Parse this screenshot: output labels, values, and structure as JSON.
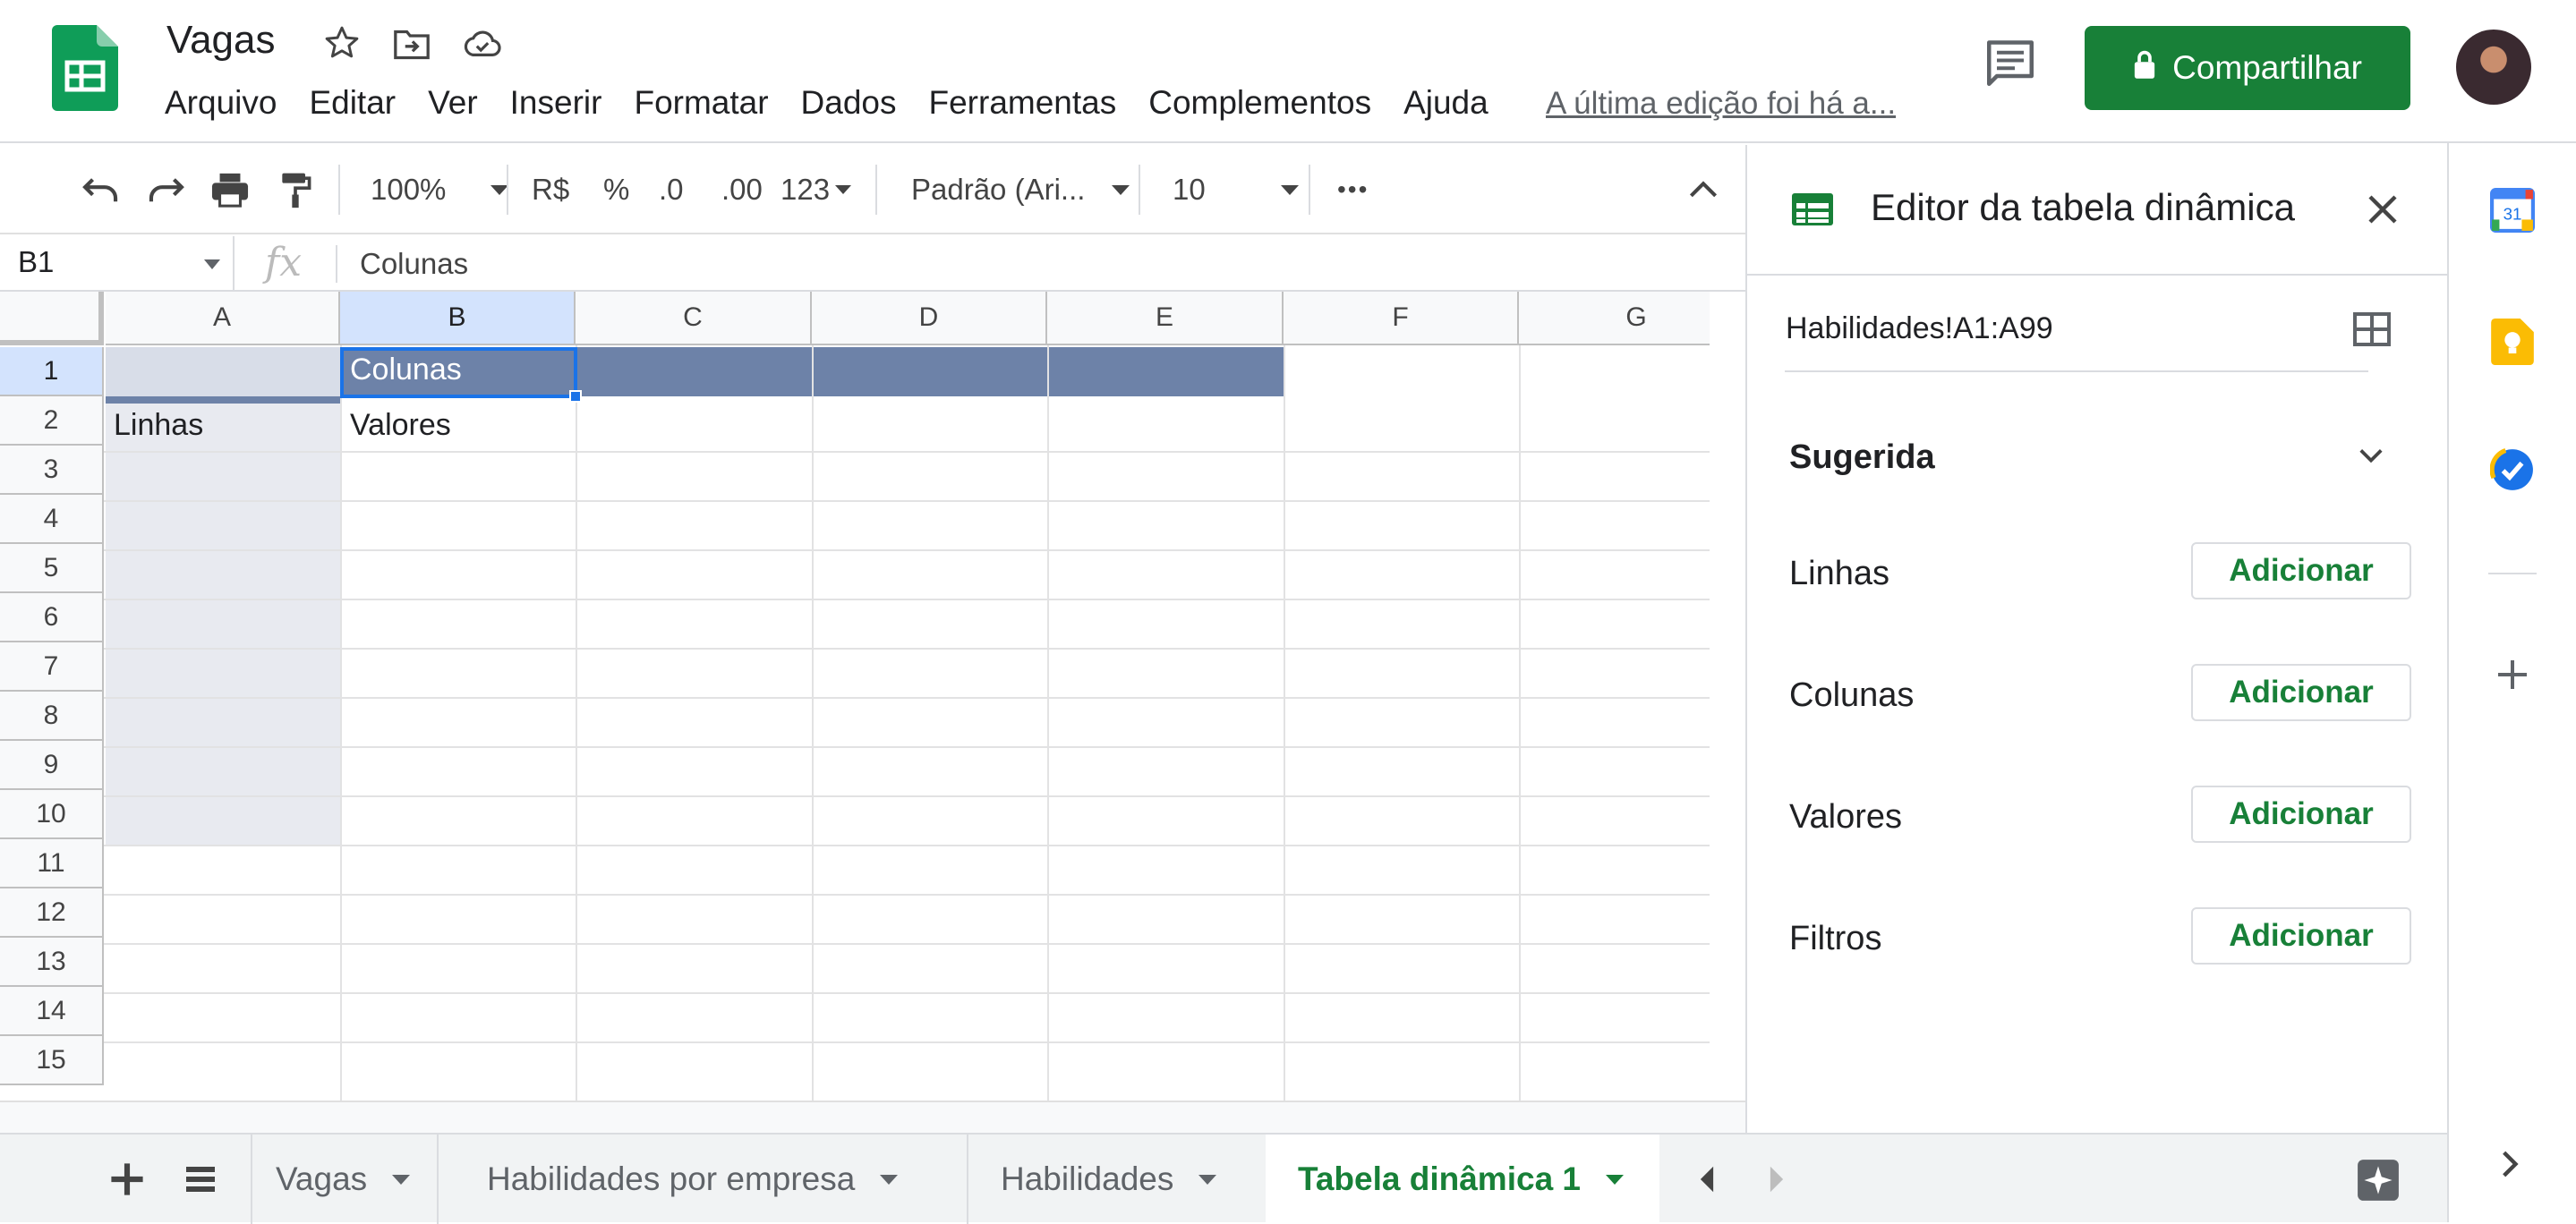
{
  "header": {
    "title": "Vagas",
    "menu": [
      "Arquivo",
      "Editar",
      "Ver",
      "Inserir",
      "Formatar",
      "Dados",
      "Ferramentas",
      "Complementos",
      "Ajuda"
    ],
    "last_edit": "A última edição foi há a...",
    "share_label": "Compartilhar"
  },
  "toolbar": {
    "zoom": "100%",
    "currency": "R$",
    "percent": "%",
    "dec_decrease": ".0",
    "dec_increase": ".00",
    "number_format": "123",
    "font": "Padrão (Ari...",
    "font_size": "10",
    "more": "•••"
  },
  "formula_bar": {
    "name_box": "B1",
    "fx": "fx",
    "content": "Colunas"
  },
  "grid": {
    "columns": [
      "A",
      "B",
      "C",
      "D",
      "E",
      "F",
      "G"
    ],
    "rows": [
      "1",
      "2",
      "3",
      "4",
      "5",
      "6",
      "7",
      "8",
      "9",
      "10",
      "11",
      "12",
      "13",
      "14",
      "15"
    ],
    "cells": {
      "b1": "Colunas",
      "a2": "Linhas",
      "b2": "Valores"
    }
  },
  "side_panel": {
    "title": "Editor da tabela dinâmica",
    "range": "Habilidades!A1:A99",
    "suggested": "Sugerida",
    "sections": [
      {
        "label": "Linhas",
        "button": "Adicionar"
      },
      {
        "label": "Colunas",
        "button": "Adicionar"
      },
      {
        "label": "Valores",
        "button": "Adicionar"
      },
      {
        "label": "Filtros",
        "button": "Adicionar"
      }
    ]
  },
  "right_rail": {
    "calendar_day": "31"
  },
  "sheets": {
    "tabs": [
      "Vagas",
      "Habilidades por empresa",
      "Habilidades",
      "Tabela dinâmica 1"
    ],
    "active_index": 3
  },
  "colors": {
    "brand_green": "#188038",
    "pivot_header": "#6d82a8",
    "selection_blue": "#1a73e8",
    "row_label_fill": "#e8eaf0"
  }
}
